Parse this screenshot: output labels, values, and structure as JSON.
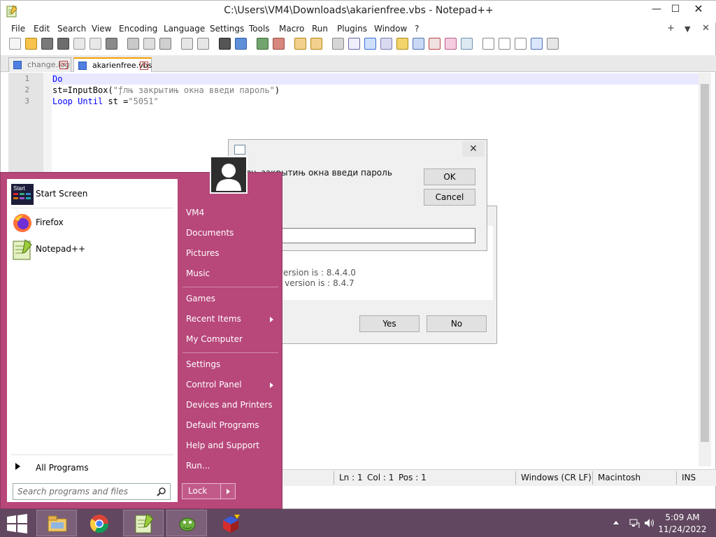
{
  "window": {
    "title": "C:\\Users\\VM4\\Downloads\\akarienfree.vbs - Notepad++",
    "min_glyph": "—",
    "max_glyph": "☐",
    "close_glyph": "✕"
  },
  "menu": [
    "File",
    "Edit",
    "Search",
    "View",
    "Encoding",
    "Language",
    "Settings",
    "Tools",
    "Macro",
    "Run",
    "Plugins",
    "Window",
    "?"
  ],
  "menu_right": [
    "+",
    "▼",
    "✕"
  ],
  "tabs": [
    {
      "label": "change.log",
      "active": false
    },
    {
      "label": "akarienfree.vbs",
      "active": true
    }
  ],
  "editor": {
    "line_numbers": [
      "1",
      "2",
      "3"
    ],
    "line1": {
      "kw": "Do"
    },
    "line2": {
      "plain": "st=InputBox(",
      "str": "\"ƒлњ закрытињ окна введи пароль\"",
      "end": ")"
    },
    "line3": {
      "kw1": "Loop",
      "kw2": "Until",
      "plain": " st =",
      "str": "\"5051\""
    }
  },
  "status": {
    "ln": "Ln : 1",
    "col": "Col : 1",
    "pos": "Pos : 1",
    "eol": "Windows (CR LF)",
    "encoding": "Macintosh",
    "mode": "INS"
  },
  "updater": {
    "current": "Current version is   : 8.4.4.0",
    "available": "Available version is : 8.4.7",
    "yes": "Yes",
    "no": "No"
  },
  "inputbox": {
    "prompt": "ƒлњ закрытињ окна введи пароль",
    "ok": "OK",
    "cancel": "Cancel",
    "close_glyph": "✕"
  },
  "start_menu": {
    "pinned": [
      {
        "label": "Start Screen",
        "icon": "start-screen-icon"
      },
      {
        "label": "Firefox",
        "icon": "firefox-icon"
      },
      {
        "label": "Notepad++",
        "icon": "notepadpp-icon"
      }
    ],
    "all_programs": "All Programs",
    "search_placeholder": "Search programs and files",
    "right": {
      "user": "VM4",
      "documents": "Documents",
      "pictures": "Pictures",
      "music": "Music",
      "games": "Games",
      "recent": "Recent Items",
      "computer": "My Computer",
      "settings": "Settings",
      "control_panel": "Control Panel",
      "devices": "Devices and Printers",
      "default_programs": "Default Programs",
      "help": "Help and Support",
      "run": "Run..."
    },
    "lock": "Lock"
  },
  "taskbar": {
    "time": "5:09 AM",
    "date": "11/24/2022"
  },
  "colors": {
    "start_menu": "#b8477a",
    "taskbar": "#61475f",
    "keyword": "#0000ff",
    "string": "#808080"
  }
}
